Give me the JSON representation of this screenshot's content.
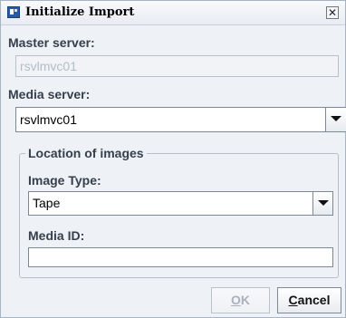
{
  "window": {
    "title": "Initialize Import",
    "close_glyph": "✕"
  },
  "master_server": {
    "label": "Master server:",
    "value": "rsvlmvc01",
    "enabled": false
  },
  "media_server": {
    "label": "Media server:",
    "value": "rsvlmvc01"
  },
  "location_of_images": {
    "group_label": "Location of images",
    "image_type": {
      "label": "Image Type:",
      "value": "Tape"
    },
    "media_id": {
      "label": "Media ID:",
      "value": ""
    }
  },
  "buttons": {
    "ok": {
      "mnemonic": "O",
      "rest": "K",
      "enabled": false
    },
    "cancel": {
      "mnemonic": "C",
      "rest": "ancel",
      "enabled": true
    }
  },
  "icons": {
    "app": "app-window-icon",
    "close": "close-icon",
    "dropdown": "chevron-down-icon"
  }
}
